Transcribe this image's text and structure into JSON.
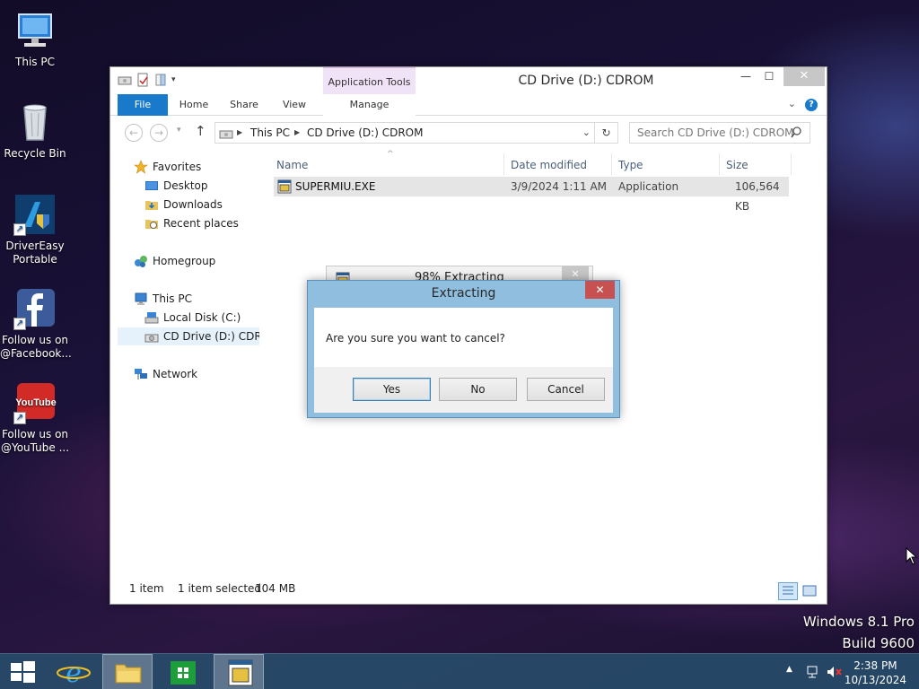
{
  "desktop": {
    "icons": [
      {
        "label": "This PC"
      },
      {
        "label": "Recycle Bin"
      },
      {
        "label": "DriverEasy Portable"
      },
      {
        "label": "Follow us on @Facebook..."
      },
      {
        "label": "Follow us on @YouTube ..."
      }
    ],
    "branding": {
      "line1": "Windows 8.1 Pro",
      "line2": "Build 9600"
    }
  },
  "explorer": {
    "title": "CD Drive (D:) CDROM",
    "context_tab_group": "Application Tools",
    "ribbon_tabs": [
      "File",
      "Home",
      "Share",
      "View",
      "Manage"
    ],
    "address": {
      "segments": [
        "This PC",
        "CD Drive (D:) CDROM"
      ]
    },
    "search": {
      "placeholder": "Search CD Drive (D:) CDROM"
    },
    "nav": {
      "favorites": "Favorites",
      "desktop": "Desktop",
      "downloads": "Downloads",
      "recent": "Recent places",
      "homegroup": "Homegroup",
      "this_pc": "This PC",
      "local_disk": "Local Disk (C:)",
      "cd_drive": "CD Drive (D:) CDROM",
      "network": "Network"
    },
    "columns": {
      "name": "Name",
      "date": "Date modified",
      "type": "Type",
      "size": "Size"
    },
    "files": [
      {
        "name": "SUPERMIU.EXE",
        "date": "3/9/2024 1:11 AM",
        "type": "Application",
        "size": "106,564 KB"
      }
    ],
    "status": {
      "count": "1 item",
      "selected": "1 item selected",
      "size": "104 MB"
    }
  },
  "progress_dialog": {
    "title": "98% Extracting"
  },
  "confirm_dialog": {
    "title": "Extracting",
    "message": "Are you sure you want to cancel?",
    "buttons": {
      "yes": "Yes",
      "no": "No",
      "cancel": "Cancel"
    }
  },
  "taskbar": {
    "time": "2:38 PM",
    "date": "10/13/2024"
  },
  "colors": {
    "accent": "#1979ca",
    "dialog_frame": "#8fbede",
    "close_red": "#c75050"
  }
}
